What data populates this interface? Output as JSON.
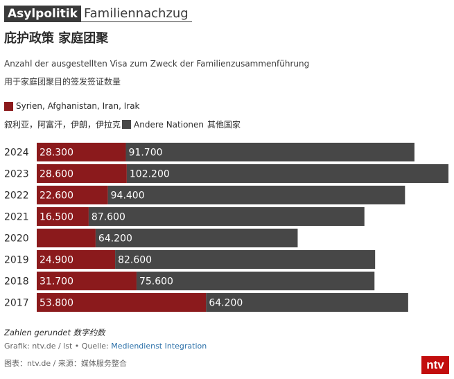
{
  "header": {
    "tag": "Asylpolitik",
    "title": "Familiennachzug"
  },
  "title_zh": "庇护政策 家庭团聚",
  "subtitle_de": "Anzahl der ausgestellten Visa zum Zweck der Familienzusammenführung",
  "subtitle_zh": "用于家庭团聚目的签发签证数量",
  "legend": {
    "series1_de": "Syrien, Afghanistan, Iran, Irak",
    "series1_zh": "叙利亚，阿富汗，伊朗，伊拉克",
    "series2_de": "Andere Nationen",
    "series2_zh": "其他国家"
  },
  "colors": {
    "series1": "#8b1a1c",
    "series2": "#474747",
    "brand": "#c20d0d"
  },
  "chart_data": {
    "type": "bar",
    "orientation": "horizontal",
    "stacked": true,
    "categories": [
      "2024",
      "2023",
      "2022",
      "2021",
      "2020",
      "2019",
      "2018",
      "2017"
    ],
    "series": [
      {
        "name": "Syrien, Afghanistan, Iran, Irak",
        "values": [
          28300,
          28600,
          22600,
          16500,
          18700,
          24900,
          31700,
          53800
        ]
      },
      {
        "name": "Andere Nationen",
        "values": [
          91700,
          102200,
          94400,
          87600,
          64200,
          82600,
          75600,
          64200
        ]
      }
    ],
    "labels": [
      [
        "28.300",
        "91.700"
      ],
      [
        "28.600",
        "102.200"
      ],
      [
        "22.600",
        "94.400"
      ],
      [
        "16.500",
        "87.600"
      ],
      [
        "",
        "64.200"
      ],
      [
        "24.900",
        "82.600"
      ],
      [
        "31.700",
        "75.600"
      ],
      [
        "53.800",
        "64.200"
      ]
    ],
    "xlim": [
      0,
      130800
    ],
    "grid": false,
    "legend_position": "top-left"
  },
  "footer": {
    "note": "Zahlen gerundet  数字约数",
    "source_prefix": "Grafik: ntv.de / lst • Quelle: ",
    "source_link": "Mediendienst Integration",
    "source_zh": "图表：ntv.de / 来源：媒体服务整合",
    "logo": "ntv"
  }
}
